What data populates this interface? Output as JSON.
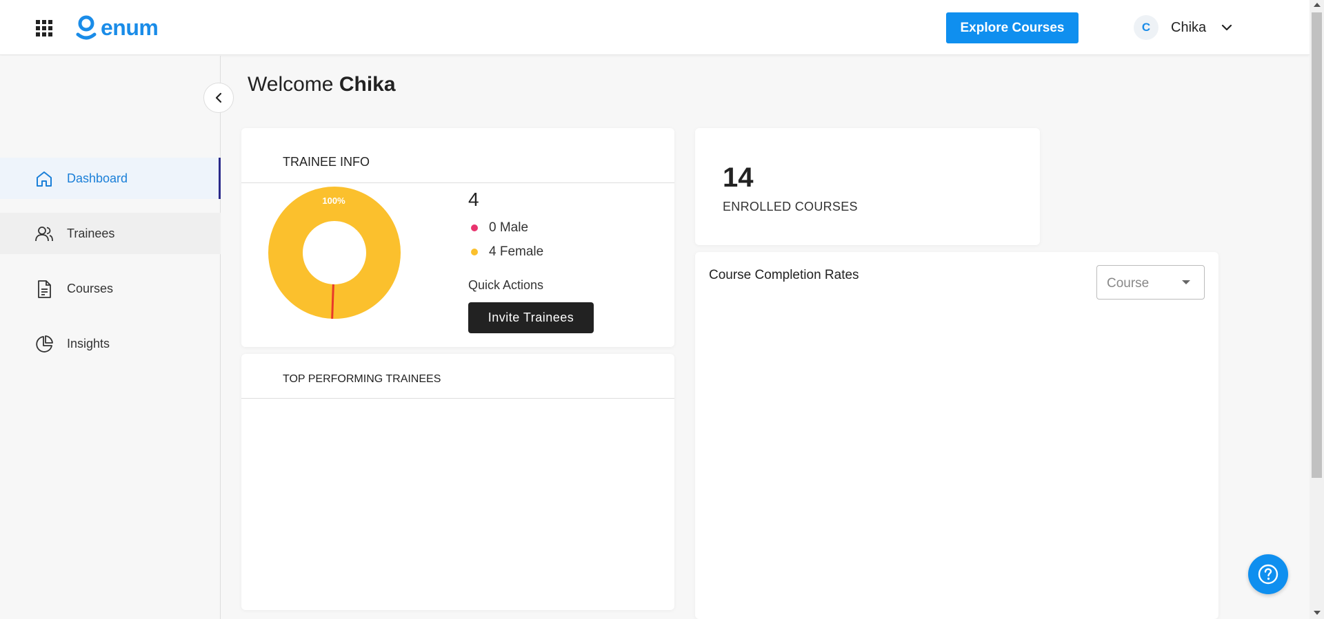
{
  "header": {
    "logo_text": "enum",
    "explore_label": "Explore Courses",
    "user": {
      "initial": "C",
      "name": "Chika"
    }
  },
  "sidebar": {
    "items": [
      {
        "label": "Dashboard",
        "icon": "home-icon",
        "active": true
      },
      {
        "label": "Trainees",
        "icon": "users-icon"
      },
      {
        "label": "Courses",
        "icon": "document-icon"
      },
      {
        "label": "Insights",
        "icon": "pie-chart-icon"
      }
    ]
  },
  "welcome": {
    "greeting": "Welcome",
    "name": "Chika"
  },
  "trainee_info": {
    "title": "TRAINEE INFO",
    "total": "4",
    "donut_label": "100%",
    "legend": [
      {
        "text": "0 Male",
        "color": "#e8336e"
      },
      {
        "text": "4 Female",
        "color": "#fbc02d"
      }
    ],
    "quick_actions_label": "Quick Actions",
    "invite_label": "Invite Trainees"
  },
  "chart_data": {
    "type": "pie",
    "categories": [
      "Male",
      "Female"
    ],
    "values": [
      0,
      4
    ],
    "colors": [
      "#e8336e",
      "#fbc02d"
    ],
    "data_labels": [
      "",
      "100%"
    ]
  },
  "top_performing": {
    "title": "TOP PERFORMING TRAINEES"
  },
  "enrolled": {
    "count": "14",
    "label": "ENROLLED COURSES"
  },
  "completion": {
    "title": "Course Completion Rates",
    "select_placeholder": "Course"
  },
  "colors": {
    "accent": "#0f8fef",
    "donut_female": "#fbc02d",
    "donut_male": "#e8336e"
  }
}
